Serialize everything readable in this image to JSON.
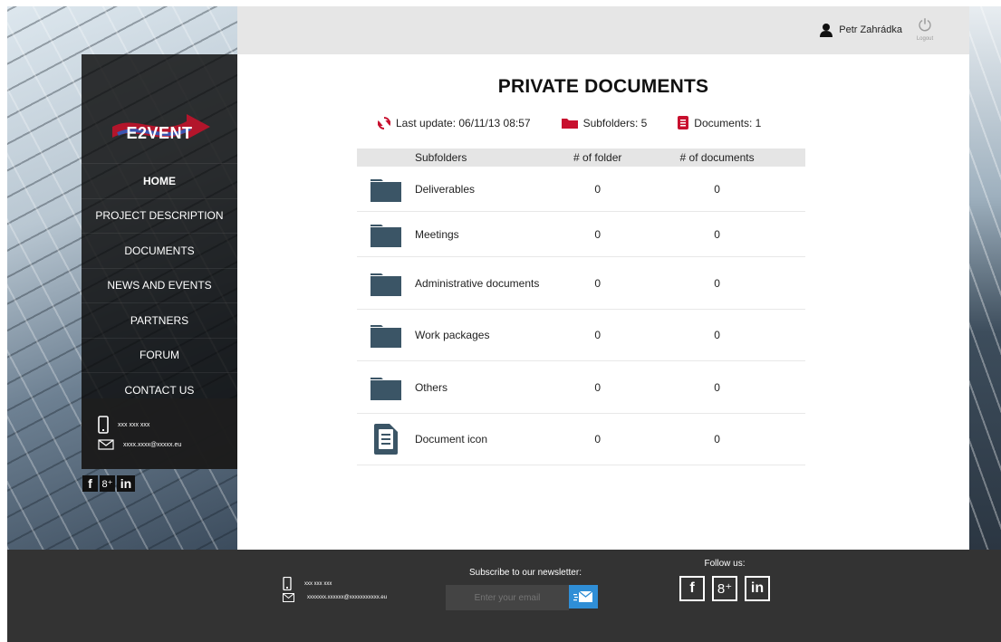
{
  "header": {
    "user_name": "Petr Zahrádka",
    "logout_label": "Logout"
  },
  "sidebar": {
    "brand": "E2VENT",
    "items": [
      {
        "label": "HOME"
      },
      {
        "label": "PROJECT DESCRIPTION"
      },
      {
        "label": "DOCUMENTS"
      },
      {
        "label": "NEWS AND EVENTS"
      },
      {
        "label": "PARTNERS"
      },
      {
        "label": "FORUM"
      },
      {
        "label": "CONTACT US"
      }
    ],
    "phone": "xxx xxx xxx",
    "email": "xxxx.xxxx@xxxxx.eu"
  },
  "main": {
    "title": "PRIVATE DOCUMENTS",
    "last_update": "Last update: 06/11/13  08:57",
    "subfolders_stat": "Subfolders:  5",
    "documents_stat": "Documents: 1",
    "table": {
      "headers": [
        "Subfolders",
        "# of folder",
        "# of documents"
      ],
      "rows": [
        {
          "name": "Deliverables",
          "folders": "0",
          "documents": "0",
          "icon": "folder-icon"
        },
        {
          "name": "Meetings",
          "folders": "0",
          "documents": "0",
          "icon": "folder-icon"
        },
        {
          "name": "Administrative documents",
          "folders": "0",
          "documents": "0",
          "icon": "folder-icon"
        },
        {
          "name": "Work packages",
          "folders": "0",
          "documents": "0",
          "icon": "folder-icon"
        },
        {
          "name": "Others",
          "folders": "0",
          "documents": "0",
          "icon": "folder-icon"
        },
        {
          "name": "Document icon",
          "folders": "0",
          "documents": "0",
          "icon": "document-icon"
        }
      ]
    }
  },
  "footer": {
    "phone": "xxx xxx xxx",
    "email": "xxxxxxx.xxxxxx@xxxxxxxxxxx.eu",
    "newsletter_label": "Subscribe to our newsletter:",
    "newsletter_placeholder": "Enter your email",
    "follow_label": "Follow us:"
  },
  "colors": {
    "accent_red": "#c8102e",
    "folder": "#3b5566",
    "footer_bg": "#333333",
    "sidebar_bg": "#0a0a0a",
    "newsletter_button": "#2f8ed6"
  }
}
